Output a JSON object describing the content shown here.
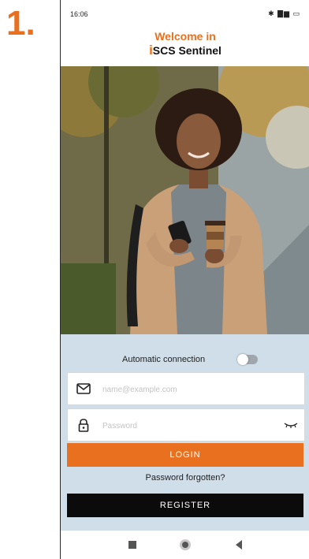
{
  "step_number": "1.",
  "status_bar": {
    "time": "16:06",
    "icons": "✱ ▇▆ ▭"
  },
  "header": {
    "welcome": "Welcome in",
    "brand_i": "i",
    "brand_rest": "SCS Sentinel"
  },
  "hero": {
    "description_icon": "woman-with-phone-photo"
  },
  "login": {
    "auto_connection_label": "Automatic connection",
    "auto_connection_enabled": false,
    "email_placeholder": "name@example.com",
    "email_value": "",
    "password_placeholder": "Password",
    "password_value": "",
    "login_label": "LOGIN",
    "forgot_label": "Password forgotten?",
    "register_label": "REGISTER"
  },
  "icons": {
    "email": "envelope-icon",
    "password": "lock-icon",
    "show_password": "eye-closed-icon"
  },
  "colors": {
    "accent": "#e8701e",
    "panel": "#cfdee8",
    "register": "#0b0b0b"
  }
}
